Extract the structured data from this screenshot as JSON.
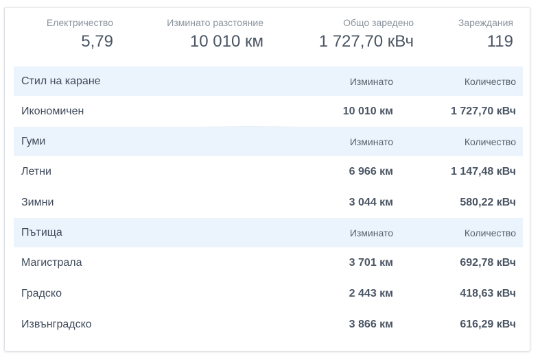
{
  "summary": {
    "electricity": {
      "label": "Електричество",
      "value": "5,79"
    },
    "distance": {
      "label": "Изминато разстояние",
      "value": "10 010 км"
    },
    "total_charged": {
      "label": "Общо заредено",
      "value": "1 727,70 кВч"
    },
    "charges": {
      "label": "Зареждания",
      "value": "119"
    }
  },
  "sections": [
    {
      "header": {
        "label": "Стил на каране",
        "col2": "Изминато",
        "col3": "Количество"
      },
      "rows": [
        {
          "label": "Икономичен",
          "distance": "10 010 км",
          "amount": "1 727,70 кВч"
        }
      ]
    },
    {
      "header": {
        "label": "Гуми",
        "col2": "Изминато",
        "col3": "Количество"
      },
      "rows": [
        {
          "label": "Летни",
          "distance": "6 966 км",
          "amount": "1 147,48 кВч"
        },
        {
          "label": "Зимни",
          "distance": "3 044 км",
          "amount": "580,22 кВч"
        }
      ]
    },
    {
      "header": {
        "label": "Пътища",
        "col2": "Изминато",
        "col3": "Количество"
      },
      "rows": [
        {
          "label": "Магистрала",
          "distance": "3 701 км",
          "amount": "692,78 кВч"
        },
        {
          "label": "Градско",
          "distance": "2 443 км",
          "amount": "418,63 кВч"
        },
        {
          "label": "Извънградско",
          "distance": "3 866 км",
          "amount": "616,29 кВч"
        }
      ]
    }
  ]
}
